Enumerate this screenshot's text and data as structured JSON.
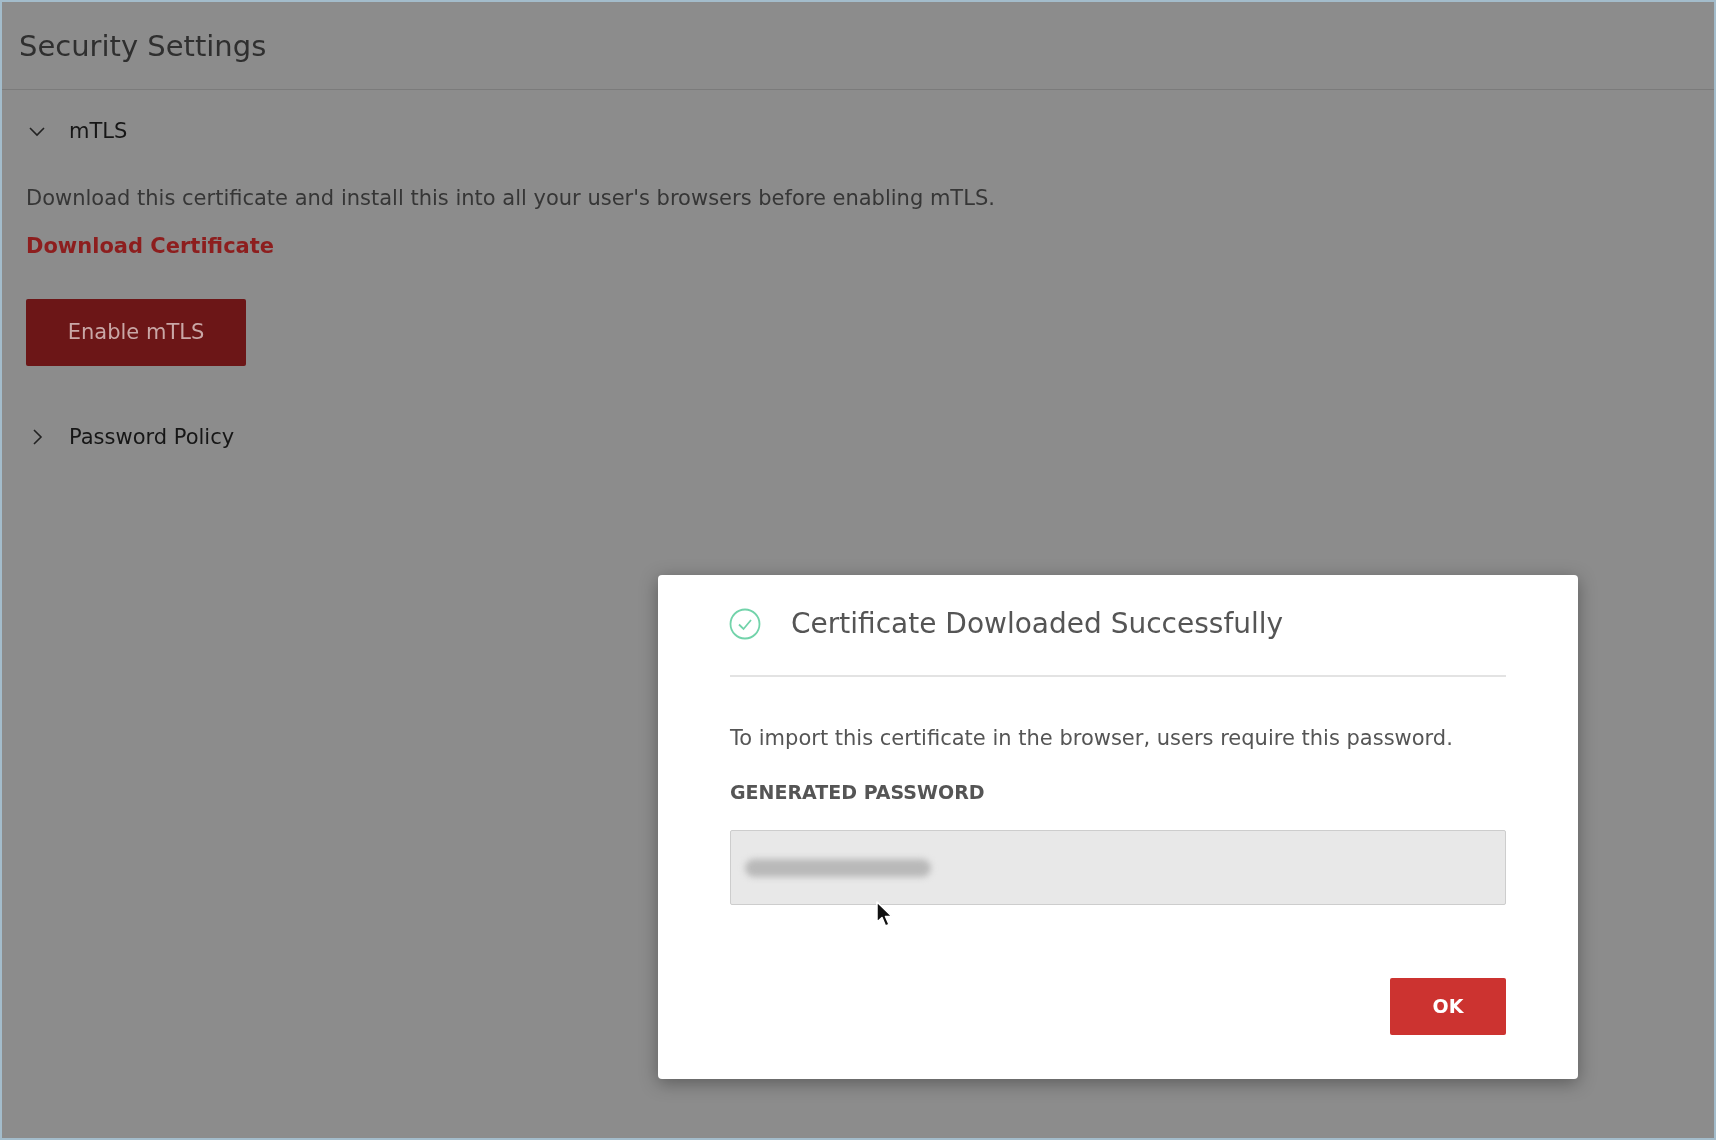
{
  "page": {
    "title": "Security Settings"
  },
  "sections": [
    {
      "title": "mTLS",
      "expanded": true,
      "description": "Download this certificate and install this into all your user's browsers before enabling mTLS.",
      "link": "Download Certificate",
      "button": "Enable mTLS"
    },
    {
      "title": "Password Policy",
      "expanded": false
    }
  ],
  "dialog": {
    "title": "Certificate Dowloaded Successfully",
    "message": "To import this certificate in the browser, users require this password.",
    "field_label": "GENERATED PASSWORD",
    "value_obscured": true,
    "buttons": [
      "OK"
    ]
  }
}
